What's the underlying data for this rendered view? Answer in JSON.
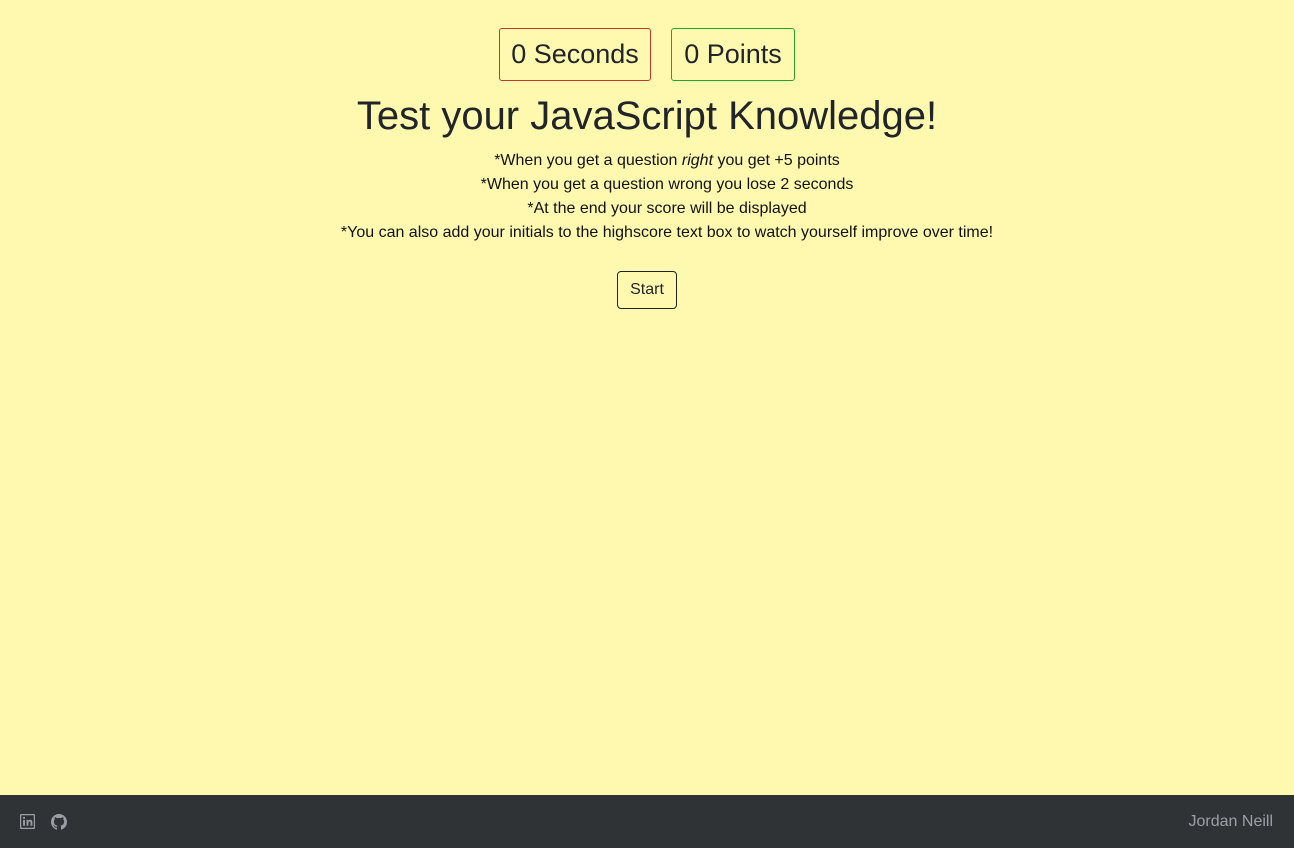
{
  "stats": {
    "seconds": "0 Seconds",
    "points": "0 Points",
    "seconds_border_color": "#c0392b",
    "points_border_color": "#2ca02c"
  },
  "title": "Test your JavaScript Knowledge!",
  "rules": {
    "line1_before": "*When you get a question ",
    "line1_emph": "right",
    "line1_after": " you get +5 points",
    "line2": "*When you get a question wrong you lose 2 seconds",
    "line3": "*At the end your score will be displayed",
    "line4": "*You can also add your initials to the highscore text box to watch yourself improve over time!"
  },
  "start_button": "Start",
  "footer": {
    "icons": [
      "linkedin-icon",
      "github-icon"
    ],
    "author": "Jordan Neill"
  },
  "colors": {
    "background": "#fff9b0",
    "footer_background": "#2f3336",
    "footer_text": "#9aa0a6"
  }
}
